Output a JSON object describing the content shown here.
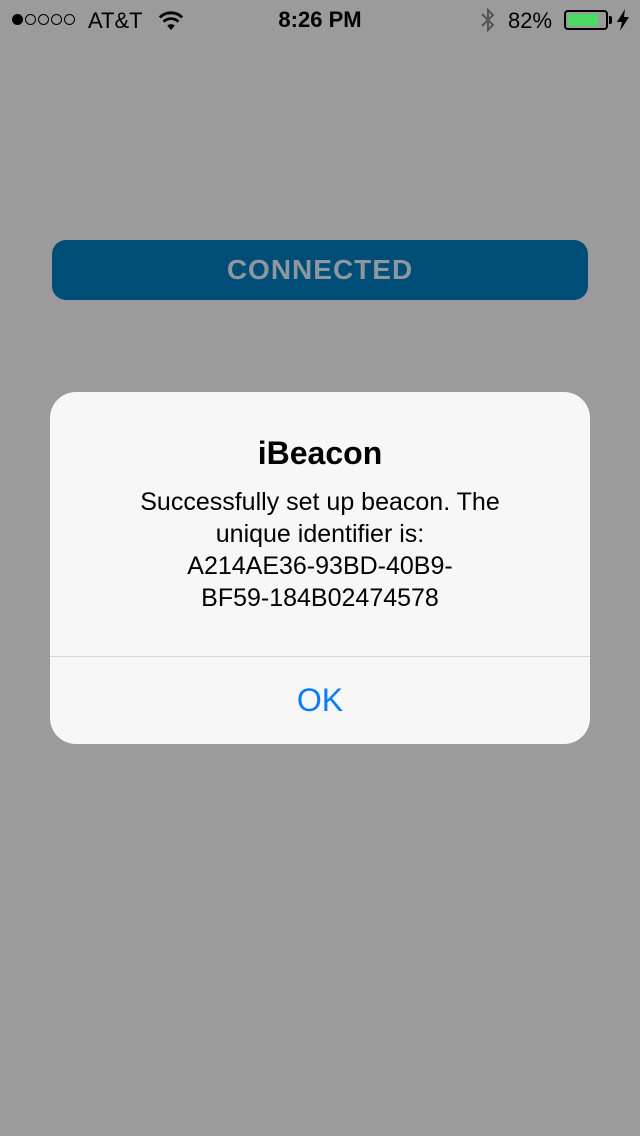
{
  "status_bar": {
    "signal_filled": 1,
    "signal_total": 5,
    "carrier": "AT&T",
    "wifi_icon": "wifi-icon",
    "time": "8:26 PM",
    "bluetooth_icon": "bluetooth-icon",
    "battery_percent": "82%",
    "battery_level": 0.82,
    "battery_color": "#4cd964",
    "charging_icon": "bolt-icon"
  },
  "main": {
    "connected_label": "CONNECTED",
    "button_color": "#004d77"
  },
  "alert": {
    "title": "iBeacon",
    "message_lines": [
      "Successfully set up beacon. The",
      "unique identifier is:",
      "A214AE36-93BD-40B9-",
      "BF59-184B02474578"
    ],
    "ok_label": "OK",
    "ok_color": "#0a7afe"
  }
}
